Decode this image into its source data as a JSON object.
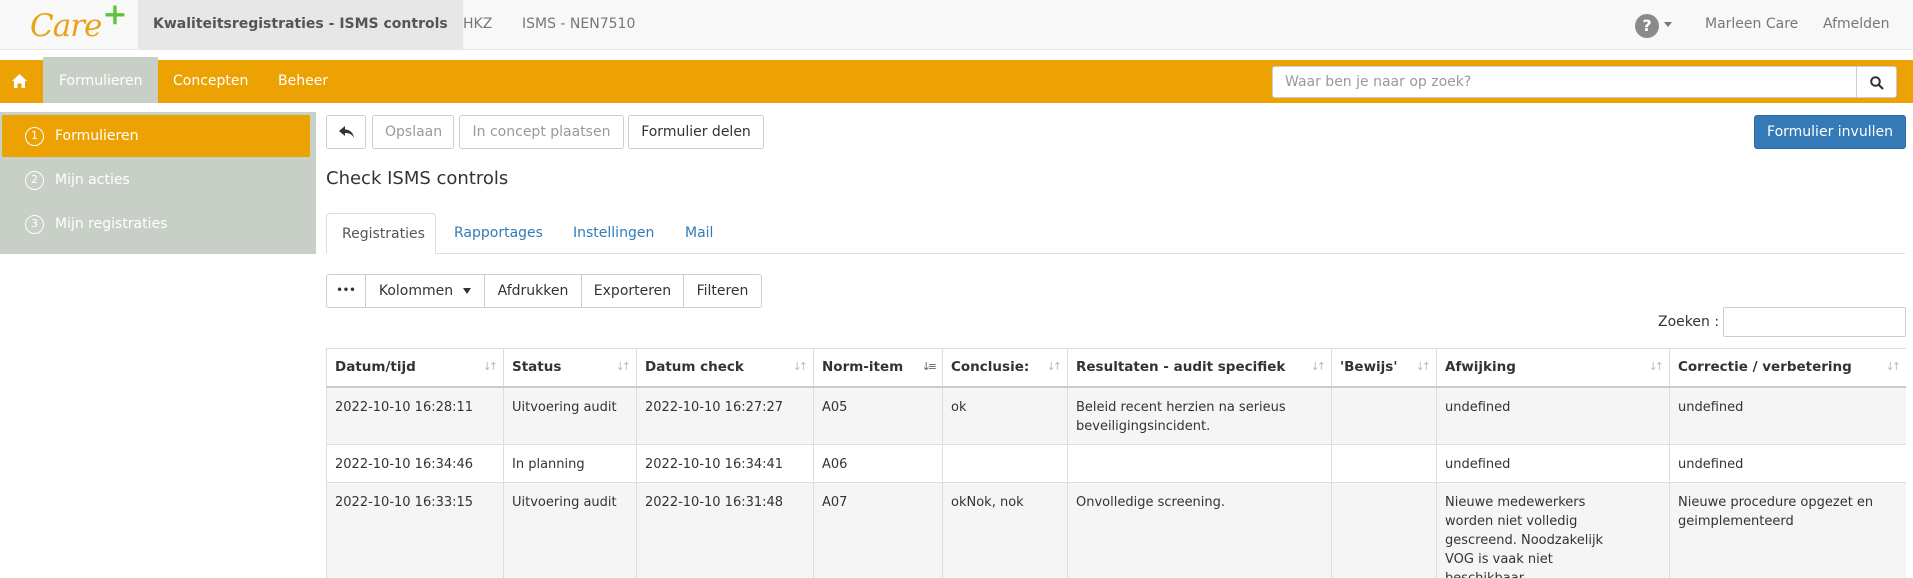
{
  "app": {
    "logo_text": "Care",
    "logo_plus": "+",
    "top_tabs": [
      {
        "label": "Kwaliteitsregistraties - ISMS controls"
      },
      {
        "label": "HKZ"
      },
      {
        "label": "ISMS - NEN7510"
      }
    ],
    "help_glyph": "?",
    "user_name": "Marleen Care",
    "logout_label": "Afmelden"
  },
  "nav": {
    "tabs": [
      {
        "label": "Formulieren"
      },
      {
        "label": "Concepten"
      },
      {
        "label": "Beheer"
      }
    ],
    "search_placeholder": "Waar ben je naar op zoek?"
  },
  "sidebar": {
    "items": [
      {
        "num": "1",
        "label": "Formulieren"
      },
      {
        "num": "2",
        "label": "Mijn acties"
      },
      {
        "num": "3",
        "label": "Mijn registraties"
      }
    ]
  },
  "toolbar": {
    "save_label": "Opslaan",
    "concept_label": "In concept plaatsen",
    "share_label": "Formulier delen",
    "fill_label": "Formulier invullen"
  },
  "page": {
    "title": "Check ISMS controls",
    "tabs": [
      {
        "label": "Registraties"
      },
      {
        "label": "Rapportages"
      },
      {
        "label": "Instellingen"
      },
      {
        "label": "Mail"
      }
    ]
  },
  "table_tools": {
    "more_label": "•••",
    "columns_label": "Kolommen",
    "print_label": "Afdrukken",
    "export_label": "Exporteren",
    "filter_label": "Filteren",
    "search_label": "Zoeken :"
  },
  "table": {
    "headers": [
      "Datum/tijd",
      "Status",
      "Datum check",
      "Norm-item",
      "Conclusie:",
      "Resultaten - audit specifiek",
      "'Bewijs'",
      "Afwijking",
      "Correctie / verbetering"
    ],
    "rows": [
      [
        "2022-10-10 16:28:11",
        "Uitvoering audit",
        "2022-10-10 16:27:27",
        "A05",
        "ok",
        "Beleid recent herzien na serieus beveiligingsincident.",
        "",
        "undefined",
        "undefined"
      ],
      [
        "2022-10-10 16:34:46",
        "In planning",
        "2022-10-10 16:34:41",
        "A06",
        "",
        "",
        "",
        "undefined",
        "undefined"
      ],
      [
        "2022-10-10 16:33:15",
        "Uitvoering audit",
        "2022-10-10 16:31:48",
        "A07",
        "okNok, nok",
        "Onvolledige screening.",
        "",
        "Nieuwe medewerkers worden niet volledig gescreend. Noodzakelijk VOG is vaak niet beschikbaar.",
        "Nieuwe procedure opgezet en geimplementeerd"
      ]
    ]
  },
  "colors": {
    "brand_orange": "#eca203",
    "sidebar_gray": "#c8cfc6",
    "primary_blue": "#337ab7",
    "logo_orange": "#e8a317",
    "logo_green": "#5cc33a"
  }
}
